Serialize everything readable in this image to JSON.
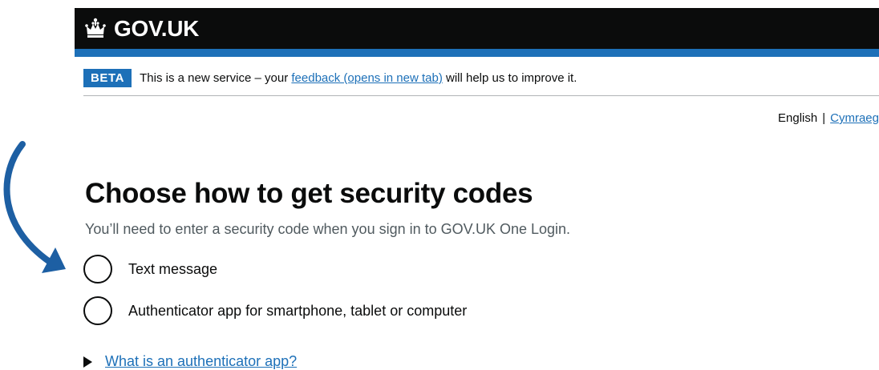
{
  "header": {
    "logo_text": "GOV.UK",
    "crown_icon": "crown-icon"
  },
  "phase_banner": {
    "tag": "BETA",
    "text_before": "This is a new service – your ",
    "link_text": "feedback (opens in new tab)",
    "text_after": " will help us to improve it."
  },
  "language": {
    "current": "English",
    "separator": "|",
    "other": "Cymraeg"
  },
  "main": {
    "heading": "Choose how to get security codes",
    "hint": "You’ll need to enter a security code when you sign in to GOV.UK One Login.",
    "options": [
      {
        "label": "Text message",
        "selected": false
      },
      {
        "label": "Authenticator app for smartphone, tablet or computer",
        "selected": false
      }
    ],
    "details_summary": "What is an authenticator app?"
  },
  "colors": {
    "brand_blue": "#1d70b8",
    "header_black": "#0b0c0c",
    "annotation_arrow": "#1d5fa3"
  }
}
